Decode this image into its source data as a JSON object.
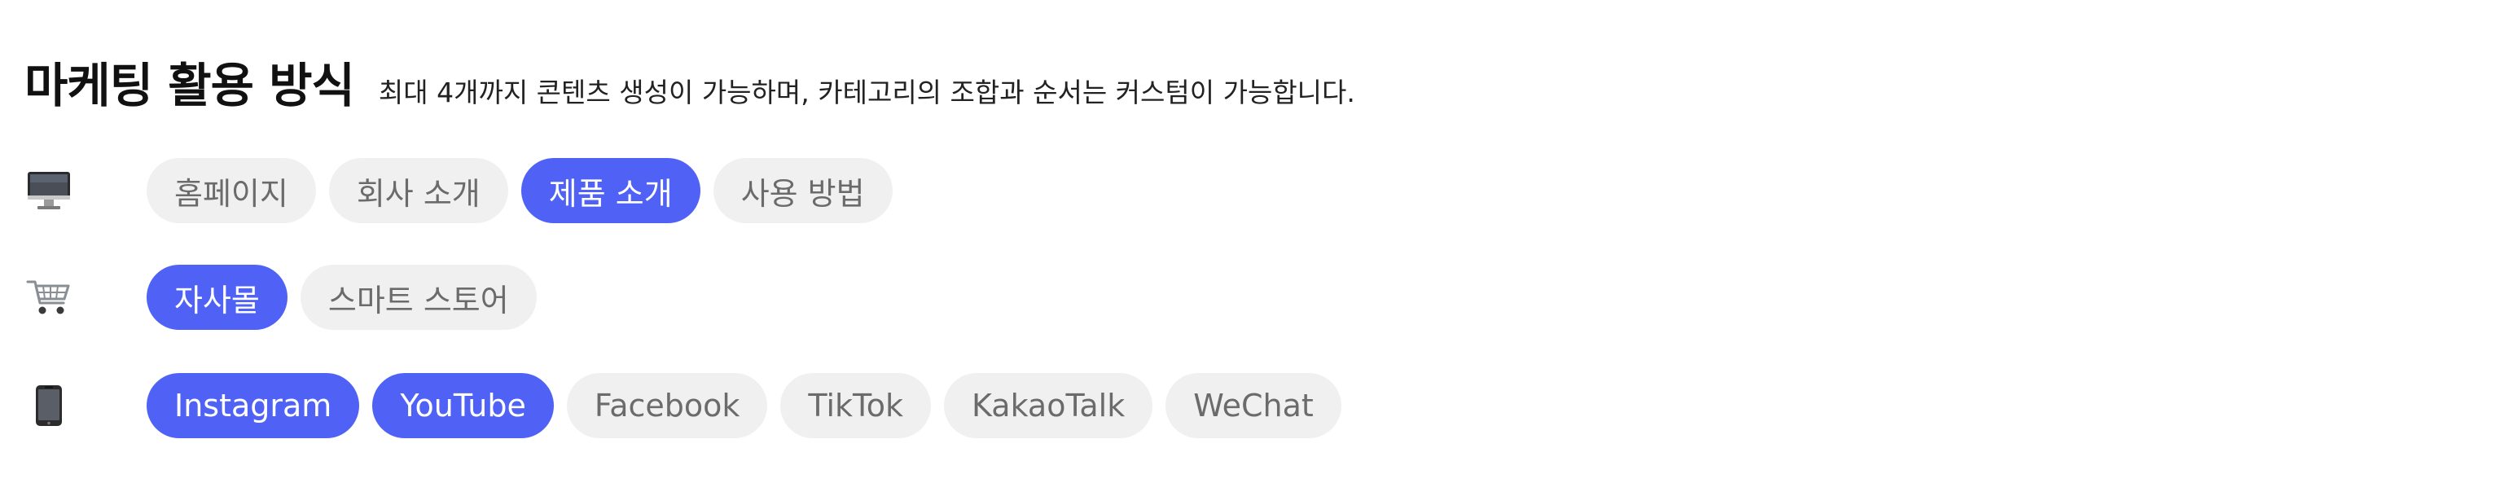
{
  "header": {
    "title": "마케팅 활용 방식",
    "subtitle": "최대 4개까지 콘텐츠 생성이 가능하며, 카테고리의 조합과 순서는 커스텀이 가능합니다."
  },
  "colors": {
    "accent": "#4f62f5",
    "chip_inactive_bg": "#f0f0f0",
    "chip_inactive_text": "#6b6b6b",
    "chip_active_text": "#ffffff"
  },
  "rows": [
    {
      "icon": "desktop-computer-icon",
      "chips": [
        {
          "label": "홈페이지",
          "selected": false
        },
        {
          "label": "회사 소개",
          "selected": false
        },
        {
          "label": "제품 소개",
          "selected": true
        },
        {
          "label": "사용 방법",
          "selected": false
        }
      ]
    },
    {
      "icon": "shopping-cart-icon",
      "chips": [
        {
          "label": "자사몰",
          "selected": true
        },
        {
          "label": "스마트 스토어",
          "selected": false
        }
      ]
    },
    {
      "icon": "mobile-phone-icon",
      "chips": [
        {
          "label": "Instagram",
          "selected": true
        },
        {
          "label": "YouTube",
          "selected": true
        },
        {
          "label": "Facebook",
          "selected": false
        },
        {
          "label": "TikTok",
          "selected": false
        },
        {
          "label": "KakaoTalk",
          "selected": false
        },
        {
          "label": "WeChat",
          "selected": false
        }
      ]
    }
  ]
}
